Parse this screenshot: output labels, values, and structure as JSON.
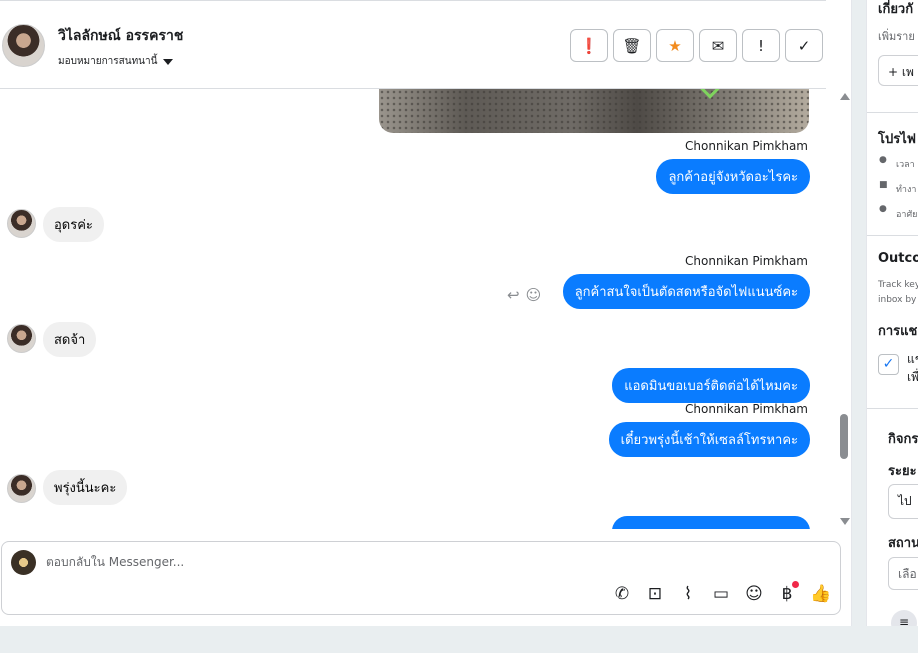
{
  "header": {
    "contact_name": "วิไลลักษณ์ อรรคราช",
    "assign_label": "มอบหมายการสนทนานี้",
    "actions": [
      {
        "name": "spam-button",
        "icon": "alert-circle-icon",
        "glyph": "❗"
      },
      {
        "name": "delete-button",
        "icon": "trash-icon",
        "glyph": "🗑"
      },
      {
        "name": "star-button",
        "icon": "star-icon",
        "glyph": "★"
      },
      {
        "name": "mark-unread-button",
        "icon": "envelope-icon",
        "glyph": "✉"
      },
      {
        "name": "follow-up-button",
        "icon": "exclamation-icon",
        "glyph": "!"
      },
      {
        "name": "mark-done-button",
        "icon": "check-icon",
        "glyph": "✓"
      }
    ]
  },
  "messages": [
    {
      "sender": "Chonnikan Pimkham",
      "text": "ลูกค้าอยู่จังหวัดอะไรคะ",
      "direction": "out"
    },
    {
      "text": "อุดรค่ะ",
      "direction": "in"
    },
    {
      "sender": "Chonnikan Pimkham",
      "text": "ลูกค้าสนใจเป็นตัดสดหรือจัดไฟแนนซ์คะ",
      "direction": "out"
    },
    {
      "text": "สดจ้า",
      "direction": "in"
    },
    {
      "text": "แอดมินขอเบอร์ติดต่อได้ไหมคะ",
      "direction": "out"
    },
    {
      "sender": "Chonnikan Pimkham",
      "text": "เดี๋ยวพรุ่งนี้เช้าให้เซลล์โทรหาคะ",
      "direction": "out"
    },
    {
      "text": "พรุ่งนี้นะคะ",
      "direction": "in"
    }
  ],
  "composer": {
    "placeholder": "ตอบกลับใน Messenger..."
  },
  "sidebar": {
    "heading_1": "เกี่ยวกั",
    "sub_1": "เพิ่มราย",
    "add_button": "+ เพ",
    "heading_2": "โปรไฟ",
    "info_1": "เวลา",
    "info_2": "ทำงา",
    "info_3": "อาศัย",
    "heading_3": "Outco",
    "sub_3a": "Track key",
    "sub_3b": "inbox by",
    "heading_4": "การแช",
    "check_label_a": "แช",
    "check_label_b": "เพื่",
    "heading_5": "กิจกร",
    "heading_6": "ระยะ",
    "field_1": "ไป",
    "heading_7": "สถาน",
    "field_2": "เลือ"
  },
  "colors": {
    "outgoing_bubble": "#0a7cff",
    "incoming_bubble": "#f0f0f0",
    "star": "#f28b1e",
    "notification_dot": "#f02849"
  }
}
